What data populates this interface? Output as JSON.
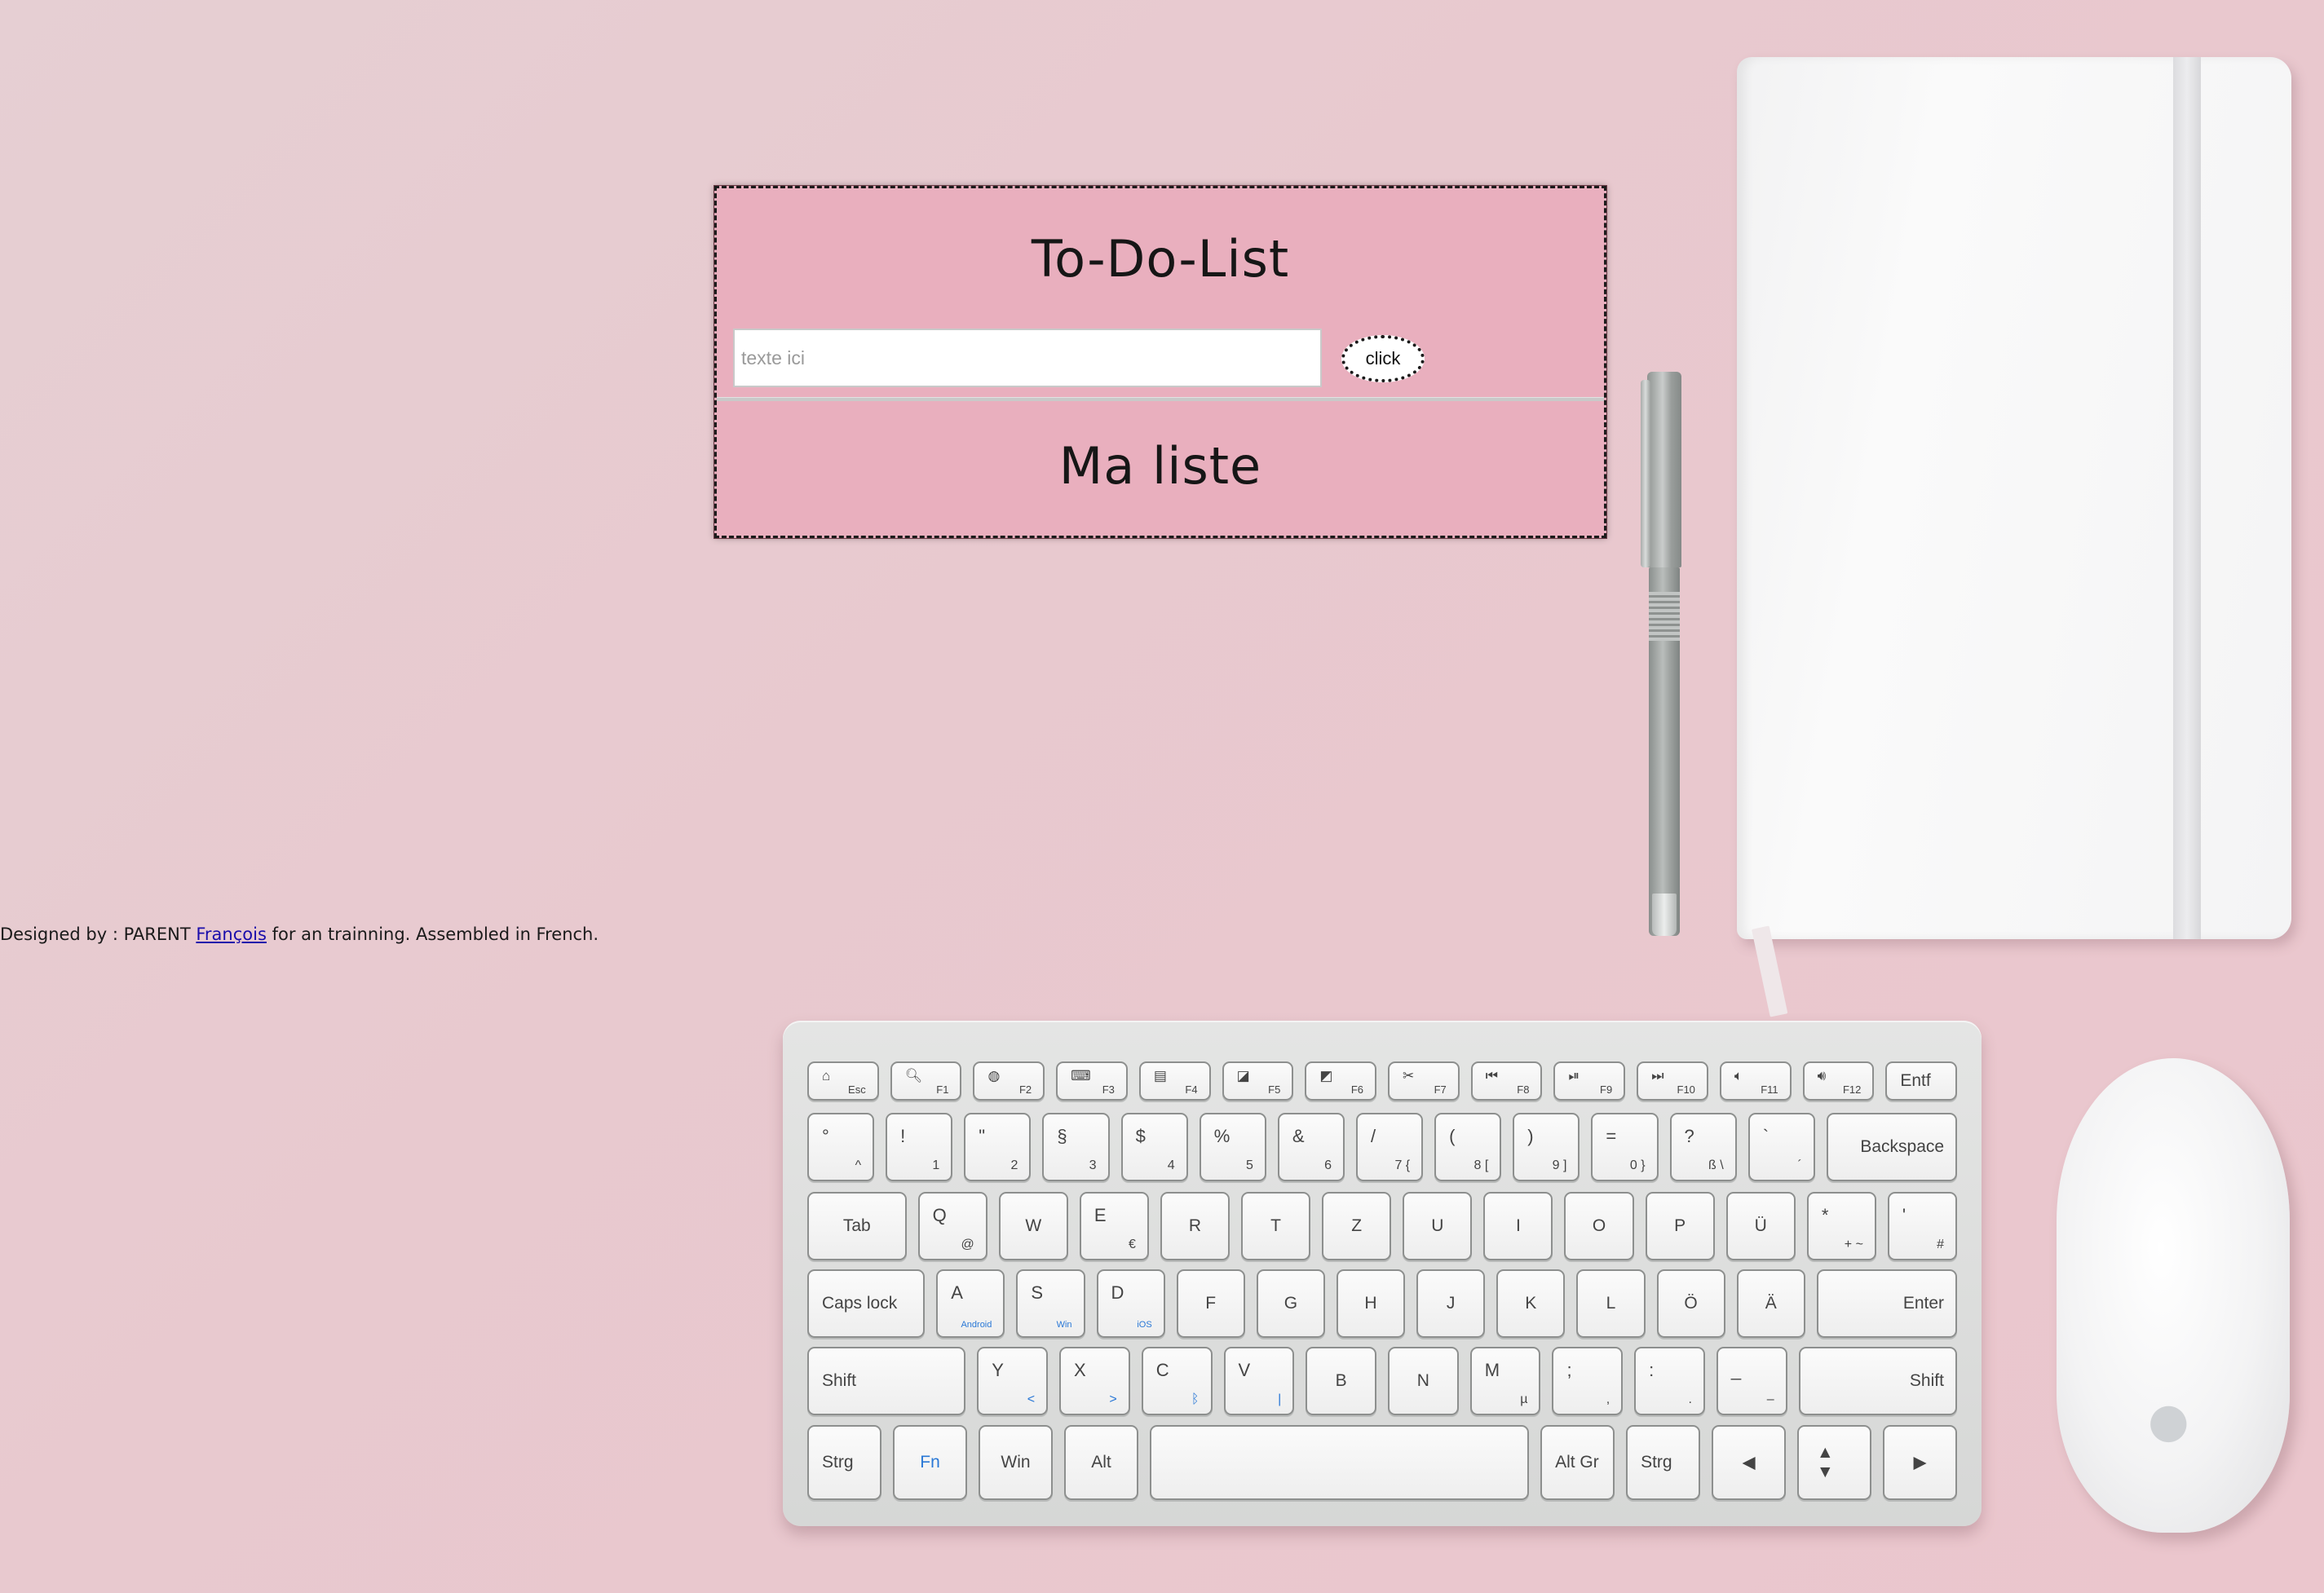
{
  "todo": {
    "title": "To-Do-List",
    "input_placeholder": "texte ici",
    "input_value": "",
    "button_label": "click",
    "list_title": "Ma liste"
  },
  "footer": {
    "prefix": "Designed by : PARENT ",
    "author_link": "François",
    "suffix": " for an trainning. Assembled in French."
  },
  "keyboard": {
    "row_fn": [
      {
        "main": "⌂",
        "sub": "Esc"
      },
      {
        "main": "🔍︎",
        "sub": "F1"
      },
      {
        "main": "◍",
        "sub": "F2"
      },
      {
        "main": "⌨",
        "sub": "F3"
      },
      {
        "main": "▤",
        "sub": "F4"
      },
      {
        "main": "◪",
        "sub": "F5"
      },
      {
        "main": "◩",
        "sub": "F6"
      },
      {
        "main": "✂",
        "sub": "F7"
      },
      {
        "main": "⏮",
        "sub": "F8"
      },
      {
        "main": "⏯",
        "sub": "F9"
      },
      {
        "main": "⏭",
        "sub": "F10"
      },
      {
        "main": "🔈︎",
        "sub": "F11"
      },
      {
        "main": "🔊︎",
        "sub": "F12"
      },
      {
        "main": "Entf",
        "sub": ""
      }
    ],
    "row_num": [
      {
        "main": "°",
        "sub": "^"
      },
      {
        "main": "!",
        "sub": "1"
      },
      {
        "main": "\"",
        "sub": "2"
      },
      {
        "main": "§",
        "sub": "3"
      },
      {
        "main": "$",
        "sub": "4"
      },
      {
        "main": "%",
        "sub": "5"
      },
      {
        "main": "&",
        "sub": "6"
      },
      {
        "main": "/",
        "sub": "7 {"
      },
      {
        "main": "(",
        "sub": "8 ["
      },
      {
        "main": ")",
        "sub": "9 ]"
      },
      {
        "main": "=",
        "sub": "0 }"
      },
      {
        "main": "?",
        "sub": "ß \\"
      },
      {
        "main": "`",
        "sub": "´"
      },
      {
        "main": "Backspace",
        "sub": ""
      }
    ],
    "row_q": [
      {
        "main": "Tab",
        "sub": ""
      },
      {
        "main": "Q",
        "sub": "@"
      },
      {
        "main": "W",
        "sub": ""
      },
      {
        "main": "E",
        "sub": "€"
      },
      {
        "main": "R",
        "sub": ""
      },
      {
        "main": "T",
        "sub": ""
      },
      {
        "main": "Z",
        "sub": ""
      },
      {
        "main": "U",
        "sub": ""
      },
      {
        "main": "I",
        "sub": ""
      },
      {
        "main": "O",
        "sub": ""
      },
      {
        "main": "P",
        "sub": ""
      },
      {
        "main": "Ü",
        "sub": ""
      },
      {
        "main": "*",
        "sub": "+ ~"
      },
      {
        "main": "'",
        "sub": "#"
      }
    ],
    "row_a": [
      {
        "main": "Caps lock",
        "sub": ""
      },
      {
        "main": "A",
        "sub": "Android"
      },
      {
        "main": "S",
        "sub": "Win"
      },
      {
        "main": "D",
        "sub": "iOS"
      },
      {
        "main": "F",
        "sub": ""
      },
      {
        "main": "G",
        "sub": ""
      },
      {
        "main": "H",
        "sub": ""
      },
      {
        "main": "J",
        "sub": ""
      },
      {
        "main": "K",
        "sub": ""
      },
      {
        "main": "L",
        "sub": ""
      },
      {
        "main": "Ö",
        "sub": ""
      },
      {
        "main": "Ä",
        "sub": ""
      },
      {
        "main": "Enter",
        "sub": ""
      }
    ],
    "row_y": [
      {
        "main": "Shift",
        "sub": ""
      },
      {
        "main": "Y",
        "sub": "<"
      },
      {
        "main": "X",
        "sub": ">"
      },
      {
        "main": "C",
        "sub": "ᛒ"
      },
      {
        "main": "V",
        "sub": "|"
      },
      {
        "main": "B",
        "sub": ""
      },
      {
        "main": "N",
        "sub": ""
      },
      {
        "main": "M",
        "sub": "µ"
      },
      {
        "main": ";",
        "sub": ","
      },
      {
        "main": ":",
        "sub": "."
      },
      {
        "main": "_",
        "sub": "–"
      },
      {
        "main": "Shift",
        "sub": ""
      }
    ],
    "row_bottom": [
      {
        "main": "Strg",
        "sub": ""
      },
      {
        "main": "Fn",
        "sub": ""
      },
      {
        "main": "Win",
        "sub": ""
      },
      {
        "main": "Alt",
        "sub": ""
      },
      {
        "main": "",
        "sub": ""
      },
      {
        "main": "Alt Gr",
        "sub": ""
      },
      {
        "main": "Strg",
        "sub": ""
      },
      {
        "main": "◀",
        "sub": ""
      },
      {
        "main": "▲ ▼",
        "sub": ""
      },
      {
        "main": "▶",
        "sub": ""
      }
    ]
  }
}
